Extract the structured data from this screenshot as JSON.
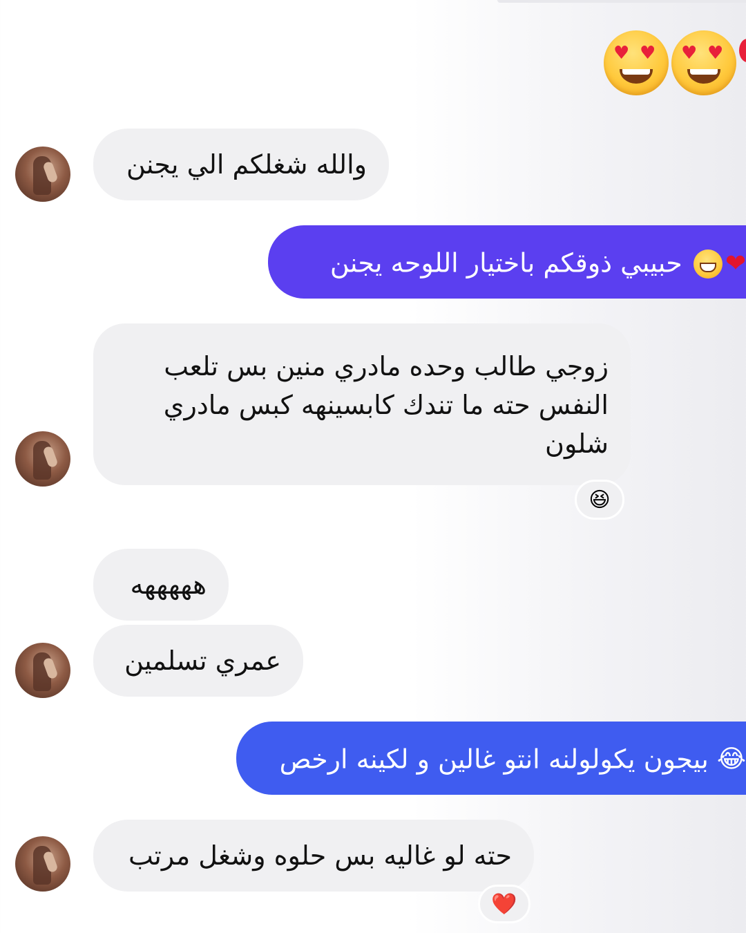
{
  "top_reaction": {
    "emojis": [
      "heart-eyes-face",
      "heart-eyes-face"
    ],
    "colors": {
      "face": "#ffc93c",
      "heart": "#e8203a"
    }
  },
  "messages": [
    {
      "id": "m1",
      "direction": "received",
      "text": "والله شغلكم الي يجنن"
    },
    {
      "id": "m2",
      "direction": "sent",
      "text": "حبيبي ذوقكم باختيار اللوحه يجنن",
      "emojis": "😁❤️",
      "color": "#5b3ff0"
    },
    {
      "id": "m3",
      "direction": "received",
      "lines": [
        "زوجي طالب وحده مادري منين بس تلعب",
        "النفس حته ما تندك كابسينهه كبس مادري",
        "شلون"
      ],
      "reaction": "😆"
    },
    {
      "id": "m4",
      "direction": "received",
      "text": "هههههه"
    },
    {
      "id": "m5",
      "direction": "received",
      "text": "عمري تسلمين"
    },
    {
      "id": "m6",
      "direction": "sent",
      "text": "بيجون يكولولنه انتو غالين و لكينه ارخص",
      "emojis": "😂",
      "color": "#3f5cf0"
    },
    {
      "id": "m7",
      "direction": "received",
      "text": "حته لو غاليه بس حلوه وشغل مرتب",
      "reaction": "❤️"
    }
  ],
  "colors": {
    "received_bubble": "#f0f0f2",
    "sent_bubble_1": "#5b3ff0",
    "sent_bubble_2": "#3f5cf0",
    "text_dark": "#111111",
    "text_light": "#ffffff"
  }
}
